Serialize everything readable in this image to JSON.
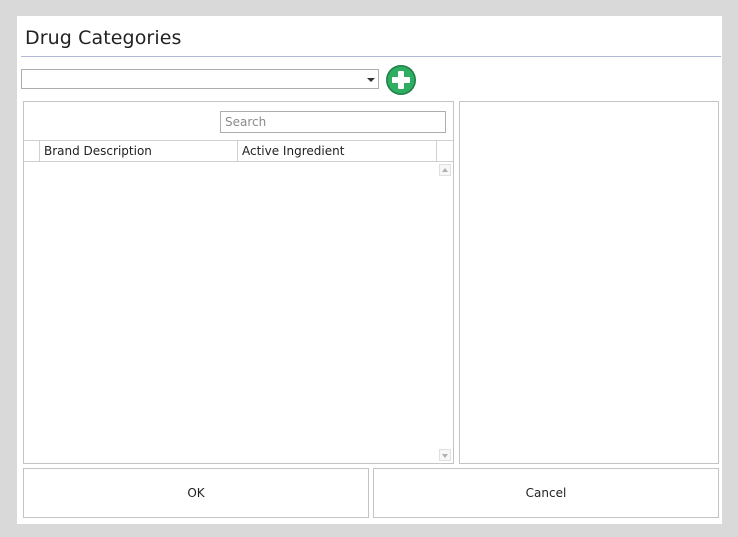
{
  "dialog": {
    "title": "Drug Categories"
  },
  "category_combo": {
    "value": ""
  },
  "add_button": {
    "icon": "plus-circle-icon",
    "color": "#2e9e5b"
  },
  "search": {
    "placeholder": "Search",
    "value": ""
  },
  "grid": {
    "columns": [
      "Brand Description",
      "Active Ingredient"
    ],
    "rows": []
  },
  "buttons": {
    "ok_label": "OK",
    "cancel_label": "Cancel"
  }
}
